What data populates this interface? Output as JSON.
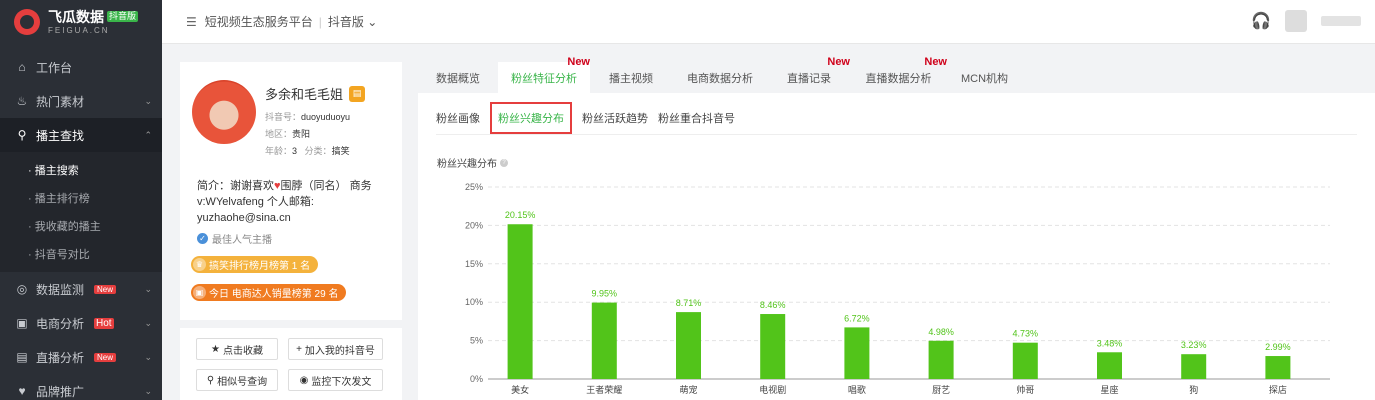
{
  "sidebar": {
    "logo_title": "飞瓜数据",
    "logo_badge": "抖音版",
    "logo_sub": "FEIGUA.CN",
    "items": [
      {
        "label": "工作台",
        "icon": "home-icon"
      },
      {
        "label": "热门素材",
        "icon": "fire-icon"
      },
      {
        "label": "播主查找",
        "icon": "search-icon"
      },
      {
        "label": "数据监测",
        "icon": "monitor-icon",
        "tag": "New"
      },
      {
        "label": "电商分析",
        "icon": "bag-icon",
        "tag": "Hot"
      },
      {
        "label": "直播分析",
        "icon": "live-icon",
        "tag": "New"
      },
      {
        "label": "品牌推广",
        "icon": "heart-icon"
      }
    ],
    "sub_items": [
      "· 播主搜索",
      "· 播主排行榜",
      "· 我收藏的播主",
      "· 抖音号对比"
    ]
  },
  "topbar": {
    "platform": "短视频生态服务平台",
    "separator": "|",
    "version": "抖音版"
  },
  "profile": {
    "name": "多余和毛毛姐",
    "douyin_label": "抖音号：",
    "douyin_id": "duoyuduoyu",
    "region_label": "地区：",
    "region": "贵阳",
    "age_label": "年龄：",
    "age": "3",
    "category_label": "分类：",
    "category": "搞笑",
    "bio_prefix": "简介：",
    "bio_1": "谢谢喜欢",
    "bio_2": "围脖（同名） 商务v:WYelvafeng 个人邮箱: yuzhaohe@sina.cn",
    "verified": "最佳人气主播",
    "rank1": "搞笑排行榜月榜第 1 名",
    "rank2": "今日 电商达人销量榜第 29 名",
    "buttons": {
      "favorite": "点击收藏",
      "add": "加入我的抖音号",
      "similar": "相似号查询",
      "monitor": "监控下次发文"
    }
  },
  "tabs": [
    {
      "label": "数据概览",
      "new": ""
    },
    {
      "label": "粉丝特征分析",
      "new": "New"
    },
    {
      "label": "播主视频",
      "new": ""
    },
    {
      "label": "电商数据分析",
      "new": ""
    },
    {
      "label": "直播记录",
      "new": "New"
    },
    {
      "label": "直播数据分析",
      "new": "New"
    },
    {
      "label": "MCN机构",
      "new": ""
    }
  ],
  "subtabs": [
    "粉丝画像",
    "粉丝兴趣分布",
    "粉丝活跃趋势",
    "粉丝重合抖音号"
  ],
  "chart_title": "粉丝兴趣分布",
  "colors": {
    "accent": "#3ab54a",
    "bar": "#52c41a",
    "alert": "#e53e3e"
  },
  "chart_data": {
    "type": "bar",
    "categories": [
      "美女",
      "王者荣耀",
      "萌宠",
      "电视剧",
      "唱歌",
      "厨艺",
      "帅哥",
      "星座",
      "狗",
      "探店"
    ],
    "values": [
      20.15,
      9.95,
      8.71,
      8.46,
      6.72,
      4.98,
      4.73,
      3.48,
      3.23,
      2.99
    ],
    "value_labels": [
      "20.15%",
      "9.95%",
      "8.71%",
      "8.46%",
      "6.72%",
      "4.98%",
      "4.73%",
      "3.48%",
      "3.23%",
      "2.99%"
    ],
    "yticks": [
      "0%",
      "5%",
      "10%",
      "15%",
      "20%",
      "25%"
    ],
    "ylim": [
      0,
      25
    ],
    "grid": true
  }
}
